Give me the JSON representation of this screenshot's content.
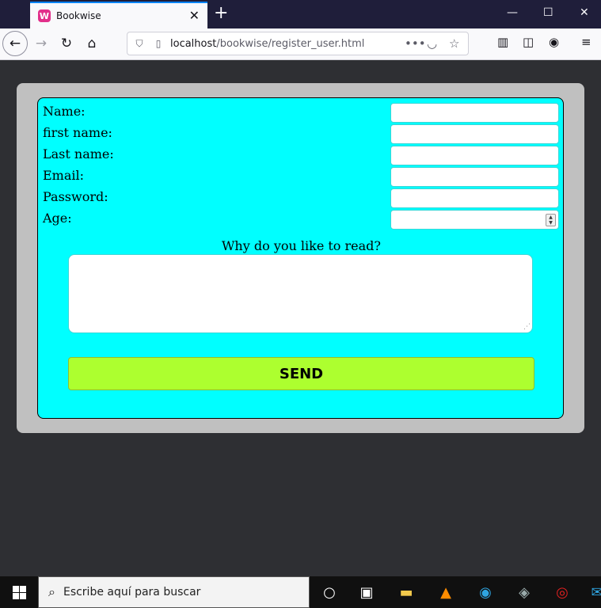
{
  "browser": {
    "tab_title": "Bookwise",
    "tab_favicon_letter": "W",
    "url_host": "localhost",
    "url_path": "/bookwise/register_user.html"
  },
  "form": {
    "fields": [
      {
        "label": "Name:",
        "value": ""
      },
      {
        "label": "first name:",
        "value": ""
      },
      {
        "label": "Last name:",
        "value": ""
      },
      {
        "label": "Email:",
        "value": ""
      },
      {
        "label": "Password:",
        "value": ""
      },
      {
        "label": "Age:",
        "value": ""
      }
    ],
    "question": "Why do you like to read?",
    "answer": "",
    "send_label": "SEND"
  },
  "taskbar": {
    "search_placeholder": "Escribe aquí para buscar"
  },
  "colors": {
    "form_bg": "#00ffff",
    "panel_bg": "#c0c0c0",
    "send_bg": "#adff2f",
    "page_bg": "#2e2f33"
  }
}
